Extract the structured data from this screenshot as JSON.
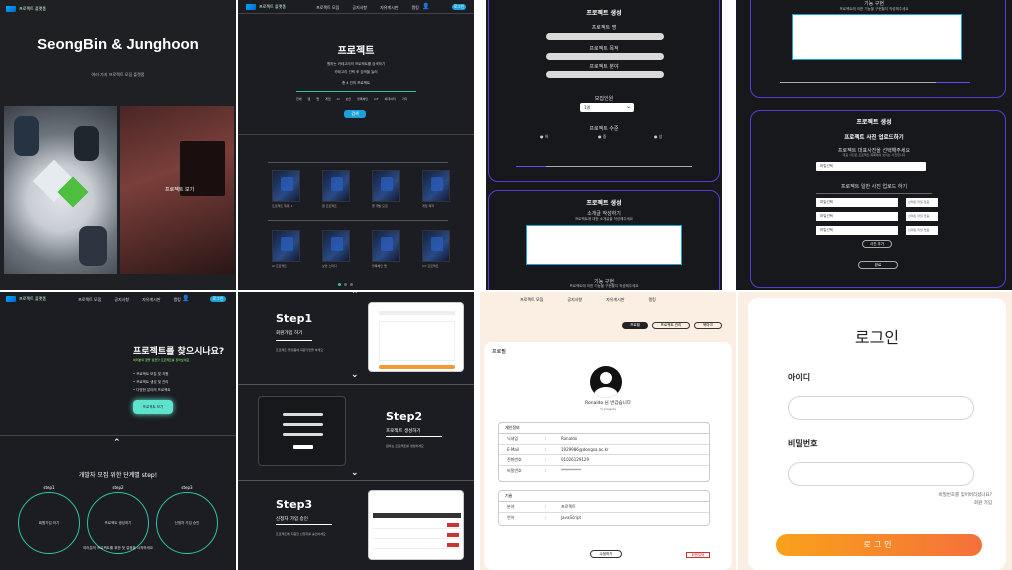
{
  "p1": {
    "brand": "프로젝트 플랫폼",
    "title": "SeongBin & Junghoon",
    "subtitle": "여러 가지 프로젝트 모집 플랫폼",
    "photo2_label": "프로젝트 보기"
  },
  "p2": {
    "brand": "프로젝트 플랫폼",
    "nav": [
      "프로젝트 모집",
      "공지사항",
      "자유게시판",
      "랭킹"
    ],
    "login": "로그인",
    "title": "프로젝트",
    "desc1": "원하는 카테고리의 프로젝트를 검색하기",
    "desc2": "카테고리 선택 후 검색을 눌러",
    "count": "총 4 건의 프로젝트",
    "cats": [
      "전체",
      "웹",
      "앱",
      "게임",
      "AI",
      "보안",
      "블록체인",
      "IoT",
      "빅데이터",
      "기타"
    ],
    "search": "검색",
    "items": [
      "프로젝트 제목 1",
      "웹 프로젝트",
      "앱 개발 모집",
      "게임 제작",
      "AI 프로젝트",
      "보안 스터디",
      "블록체인 앱",
      "IoT 프로젝트"
    ]
  },
  "p3": {
    "title": "프로젝트 생성",
    "f1": "프로젝트 명",
    "f2": "프로젝트 목적",
    "f3": "프로젝트 분야",
    "recruit": "모집인원",
    "recruit_val": "1명",
    "level": "프로젝트 수준",
    "levels": [
      "하",
      "중",
      "상"
    ],
    "title2": "프로젝트 생성",
    "intro": "소개글 작성하기",
    "intro_desc": "프로젝트에 대한 소개글을 작성해주세요",
    "skill": "기능 구현",
    "skill_desc": "프로젝트에 의한 기능을 구현할지 작성해주세요"
  },
  "p4": {
    "skill": "기능 구현",
    "skill_desc": "프로젝트에 의한 기능을 구현할지 작성해주세요",
    "title": "프로젝트 생성",
    "upload": "프로젝트 사진 업로드하기",
    "rep": "프로젝트 대표사진을 선택해주세요",
    "rep_desc": "대표 사진은 프로젝트 목록에서 보이는 사진입니다",
    "file": "파일선택",
    "none": "선택된 파일 없음",
    "extra": "프로젝트 일반 사진 업로드 하기",
    "add": "사진 추가",
    "done": "완료"
  },
  "p5": {
    "brand": "프로젝트 플랫폼",
    "title": "프로젝트를 찾으시나요?",
    "sub": "여러분의 꿈을 실현할 프로젝트를 찾아보세요",
    "bullets": [
      "프로젝트 모집 및 지원",
      "프로젝트 생성 및 관리",
      "다양한 분야의 프로젝트"
    ],
    "cta": "프로젝트 보기",
    "steps_title": "개발자 모집 위한 단계별 step!",
    "steps": [
      {
        "n": "step1",
        "t": "회원가입 하기"
      },
      {
        "n": "step2",
        "t": "프로젝트 생성하기"
      },
      {
        "n": "step3",
        "t": "신청자 가입 승인"
      }
    ],
    "footer": "여러분의 프로젝트를 위한 첫 걸음을 시작하세요"
  },
  "p6": {
    "s1": "Step1",
    "s1t": "회원가입 하기",
    "s1d": "프로젝트 플랫폼에 회원가입을 하세요",
    "s2": "Step2",
    "s2t": "프로젝트 생성하기",
    "s2d": "원하는 프로젝트를 생성하세요",
    "s3": "Step3",
    "s3t": "신청자 가입 승인",
    "s3d": "프로젝트에 지원한 신청자를 승인하세요"
  },
  "p7": {
    "nav": [
      "프로젝트 모집",
      "공지사항",
      "자유게시판",
      "랭킹"
    ],
    "tabs": [
      "프로필",
      "프로젝트 관리",
      "북마크"
    ],
    "section": "프로필",
    "greeting": "Ronaldo 님 반갑습니다",
    "sub": "% projects",
    "personal": "개인정보",
    "rows": [
      [
        "닉네임",
        "Ronaldo"
      ],
      [
        "E-Mail",
        "1929986@dongsa.ac.kr"
      ],
      [
        "전화번호",
        "01026129129"
      ],
      [
        "비밀번호",
        "**********"
      ]
    ],
    "tech": "기술",
    "trows": [
      [
        "분야",
        "프로젝트"
      ],
      [
        "언어",
        "JavaScript"
      ]
    ],
    "edit": "수정하기",
    "withdraw": "회원탈퇴"
  },
  "p8": {
    "title": "로그인",
    "id": "아이디",
    "pw": "비밀번호",
    "forgot": "비밀번호를 잊어버리셨나요?",
    "signup": "회원 가입",
    "button": "로그인"
  }
}
